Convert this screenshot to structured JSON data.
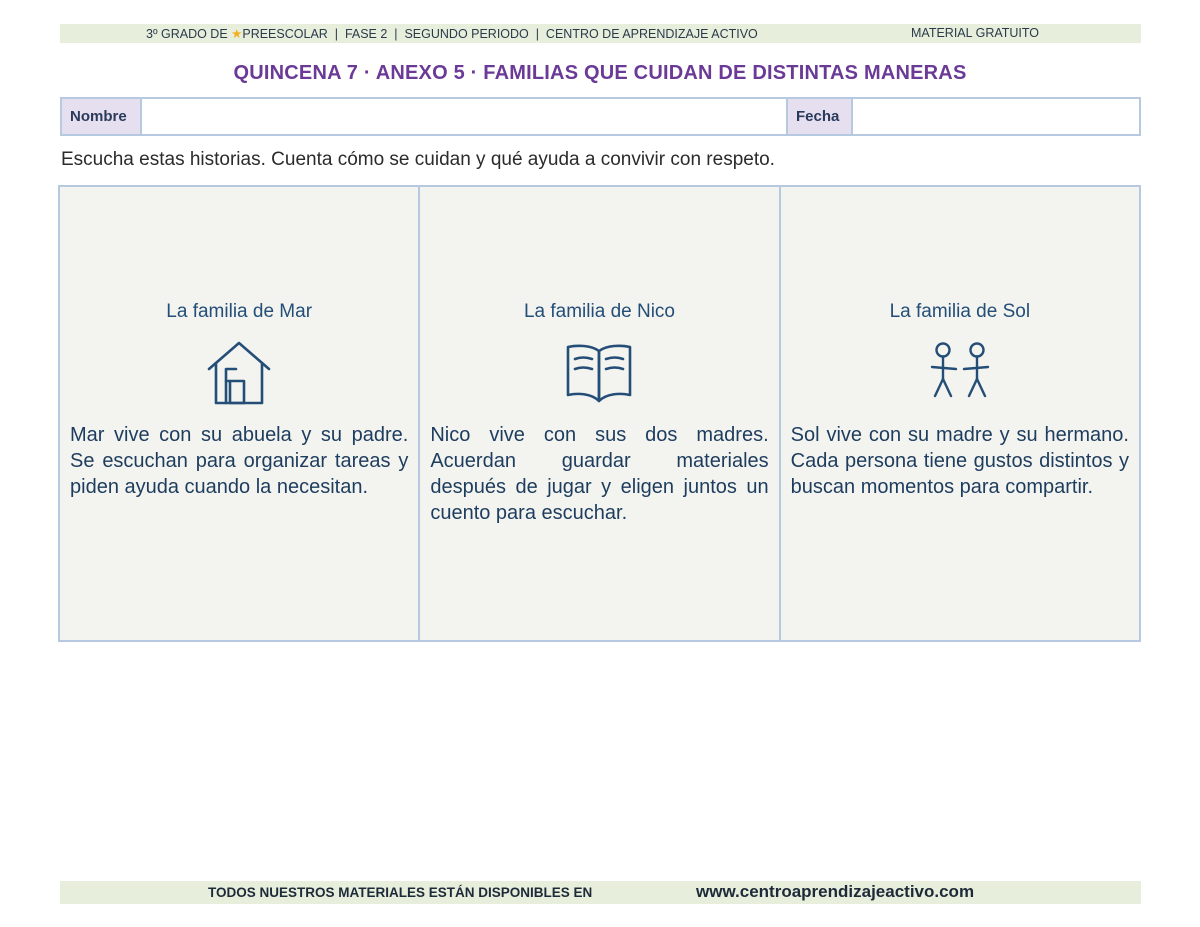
{
  "header": {
    "banner_left_prefix": "3º GRADO DE ",
    "banner_left_suffix": "PREESCOLAR  |  FASE 2  |  SEGUNDO PERIODO  |  CENTRO DE APRENDIZAJE ACTIVO",
    "banner_right": "MATERIAL GRATUITO",
    "title": "QUINCENA 7 · ANEXO 5 · FAMILIAS QUE CUIDAN DE DISTINTAS MANERAS"
  },
  "form": {
    "name_label": "Nombre",
    "name_value": "",
    "date_label": "Fecha",
    "date_value": ""
  },
  "instructions": "Escucha estas historias. Cuenta cómo se cuidan y qué ayuda a convivir con respeto.",
  "cards": [
    {
      "title": "La familia de Mar",
      "icon": "house-icon",
      "text": "Mar vive con su abuela y su padre. Se escuchan para organizar tareas y piden ayuda cuando la necesitan."
    },
    {
      "title": "La familia de Nico",
      "icon": "book-icon",
      "text": "Nico vive con sus dos madres. Acuerdan guardar materiales después de jugar y eligen juntos un cuento para escuchar."
    },
    {
      "title": "La familia de Sol",
      "icon": "two-people-icon",
      "text": "Sol vive con su madre y su hermano. Cada persona tiene gustos distintos y buscan momentos para compartir."
    }
  ],
  "footer": {
    "left_text": "TODOS NUESTROS MATERIALES ESTÁN DISPONIBLES EN",
    "website": "www.centroaprendizajeactivo.com"
  },
  "colors": {
    "title": "#6a3a96",
    "card_heading": "#244e78",
    "banner_bg": "#e8eedc",
    "card_bg": "#f3f4ef",
    "border": "#b7c9e0",
    "label_bg": "#e6dff0"
  }
}
